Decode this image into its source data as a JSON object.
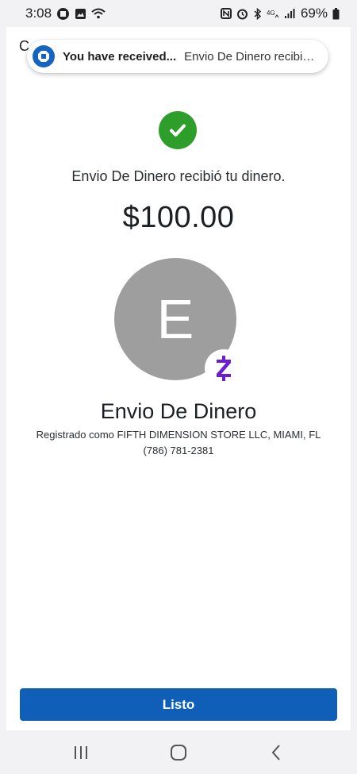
{
  "status_bar": {
    "time": "3:08",
    "battery": "69%",
    "left_icons": [
      "app-notification-icon",
      "gallery-icon",
      "wifi-icon"
    ],
    "right_icons": [
      "nfc-icon",
      "alarm-icon",
      "bluetooth-icon",
      "4g-icon",
      "signal-icon",
      "battery-icon"
    ]
  },
  "app_header": {
    "letter": "C"
  },
  "notification": {
    "title": "You have received...",
    "body": "Envio De Dinero recibió..."
  },
  "confirmation": {
    "message": "Envio De Dinero recibió tu dinero.",
    "amount": "$100.00"
  },
  "recipient": {
    "avatar_letter": "E",
    "name": "Envio De Dinero",
    "registered": "Registrado como FIFTH DIMENSION STORE LLC, MIAMI, FL",
    "phone": "(786) 781-2381"
  },
  "actions": {
    "done_label": "Listo"
  },
  "colors": {
    "accent": "#0f5fb8",
    "success": "#2e9e2b",
    "avatar": "#9e9e9e",
    "zelle": "#6d1ed4"
  }
}
